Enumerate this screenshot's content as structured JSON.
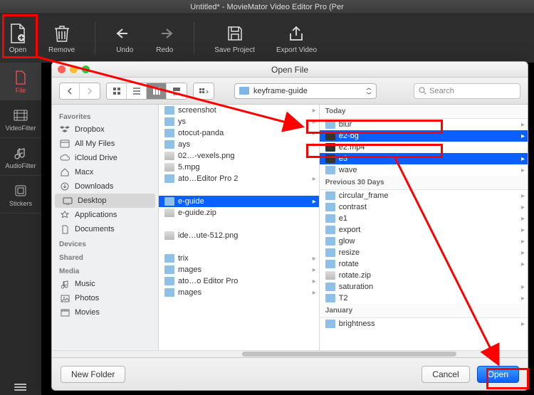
{
  "window_title": "Untitled* - MovieMator Video Editor Pro (Per",
  "toolbar": {
    "open": "Open",
    "remove": "Remove",
    "undo": "Undo",
    "redo": "Redo",
    "save": "Save Project",
    "export": "Export Video"
  },
  "sidetabs": {
    "file": "File",
    "video_filter": "VideoFilter",
    "audio_filter": "AudioFilter",
    "stickers": "Stickers"
  },
  "dialog": {
    "title": "Open File",
    "path_label": "keyframe-guide",
    "search_placeholder": "Search",
    "new_folder": "New Folder",
    "cancel": "Cancel",
    "open": "Open",
    "sidebar": {
      "favorites": "Favorites",
      "items_fav": [
        "Dropbox",
        "All My Files",
        "iCloud Drive",
        "Macx",
        "Downloads",
        "Desktop",
        "Applications",
        "Documents"
      ],
      "devices": "Devices",
      "shared": "Shared",
      "media": "Media",
      "items_media": [
        "Music",
        "Photos",
        "Movies"
      ]
    },
    "col1": {
      "items": [
        "screenshot",
        "ys",
        "otocut-panda",
        "ays",
        "02…-vexels.png",
        "5.mpg",
        "ato…Editor Pro 2",
        "",
        "e-guide",
        "e-guide.zip",
        "",
        "ide…ute-512.png",
        "",
        "trix",
        "mages",
        "ato…o Editor Pro",
        "mages"
      ]
    },
    "col2": {
      "hdr_today": "Today",
      "today": [
        "blur",
        "e2-bg",
        "e2.mp4",
        "e3",
        "wave"
      ],
      "hdr_prev": "Previous 30 Days",
      "prev": [
        "circular_frame",
        "contrast",
        "e1",
        "export",
        "glow",
        "resize",
        "rotate",
        "rotate.zip",
        "saturation",
        "T2"
      ],
      "hdr_jan": "January",
      "jan": [
        "brightness"
      ]
    }
  }
}
